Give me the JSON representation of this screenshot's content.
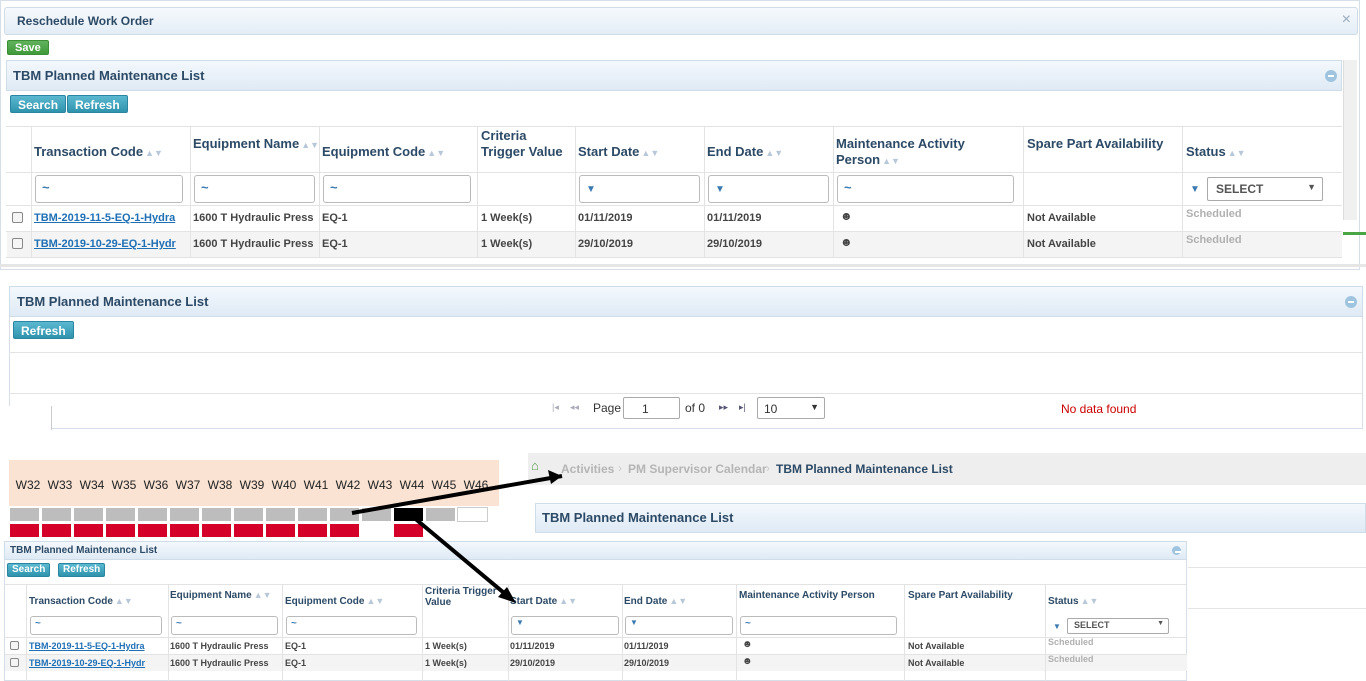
{
  "dialog": {
    "title": "Reschedule Work Order",
    "close_symbol": "×",
    "save_label": "Save"
  },
  "top_panel": {
    "title": "TBM Planned Maintenance List",
    "search_label": "Search",
    "refresh_label": "Refresh",
    "columns": [
      "Transaction Code",
      "Equipment Name",
      "Equipment Code",
      "Criteria Trigger Value",
      "Start Date",
      "End Date",
      "Maintenance Activity Person",
      "Spare Part Availability",
      "Status"
    ],
    "filter_tilde": "~",
    "status_select": "SELECT",
    "rows": [
      {
        "transaction_code": "TBM-2019-11-5-EQ-1-Hydra",
        "equipment_name": "1600 T Hydraulic Press",
        "equipment_code": "EQ-1",
        "criteria": "1 Week(s)",
        "start": "01/11/2019",
        "end": "01/11/2019",
        "spare": "Not Available",
        "status": "Scheduled"
      },
      {
        "transaction_code": "TBM-2019-10-29-EQ-1-Hydr",
        "equipment_name": "1600 T Hydraulic Press",
        "equipment_code": "EQ-1",
        "criteria": "1 Week(s)",
        "start": "29/10/2019",
        "end": "29/10/2019",
        "spare": "Not Available",
        "status": "Scheduled"
      }
    ]
  },
  "middle_panel": {
    "title": "TBM Planned Maintenance List",
    "refresh_label": "Refresh",
    "pager": {
      "page_label": "Page",
      "page_value": "1",
      "of_label": "of 0",
      "page_size": "10",
      "first": "|◂",
      "prev": "◂◂",
      "next": "▸▸",
      "last": "▸|"
    },
    "no_data": "No data found"
  },
  "calendar": {
    "weeks": [
      "W32",
      "W33",
      "W34",
      "W35",
      "W36",
      "W37",
      "W38",
      "W39",
      "W40",
      "W41",
      "W42",
      "W43",
      "W44",
      "W45",
      "W46"
    ]
  },
  "breadcrumb": {
    "items": [
      "Activities",
      "PM Supervisor Calendar",
      "TBM Planned Maintenance List"
    ]
  },
  "lower_title": "TBM Planned Maintenance List",
  "small_panel": {
    "title": "TBM Planned Maintenance List",
    "search_label": "Search",
    "refresh_label": "Refresh",
    "columns": [
      "Transaction Code",
      "Equipment Name",
      "Equipment Code",
      "Criteria Trigger Value",
      "Start Date",
      "End Date",
      "Maintenance Activity Person",
      "Spare Part Availability",
      "Status"
    ],
    "status_select": "SELECT",
    "rows": [
      {
        "transaction_code": "TBM-2019-11-5-EQ-1-Hydra",
        "equipment_name": "1600 T Hydraulic Press",
        "equipment_code": "EQ-1",
        "criteria": "1 Week(s)",
        "start": "01/11/2019",
        "end": "01/11/2019",
        "spare": "Not Available",
        "status": "Scheduled"
      },
      {
        "transaction_code": "TBM-2019-10-29-EQ-1-Hydr",
        "equipment_name": "1600 T Hydraulic Press",
        "equipment_code": "EQ-1",
        "criteria": "1 Week(s)",
        "start": "29/10/2019",
        "end": "29/10/2019",
        "spare": "Not Available",
        "status": "Scheduled"
      }
    ]
  },
  "colors": {
    "accent": "#2f93ad",
    "save_green": "#4aa545",
    "calendar_red": "#d4002a",
    "calendar_gray": "#bdbdbd",
    "calendar_header": "#fbe3d3",
    "no_data_red": "#cc0000"
  },
  "icons": {
    "person": "person-icon",
    "home": "home-icon",
    "filter": "filter-icon"
  }
}
